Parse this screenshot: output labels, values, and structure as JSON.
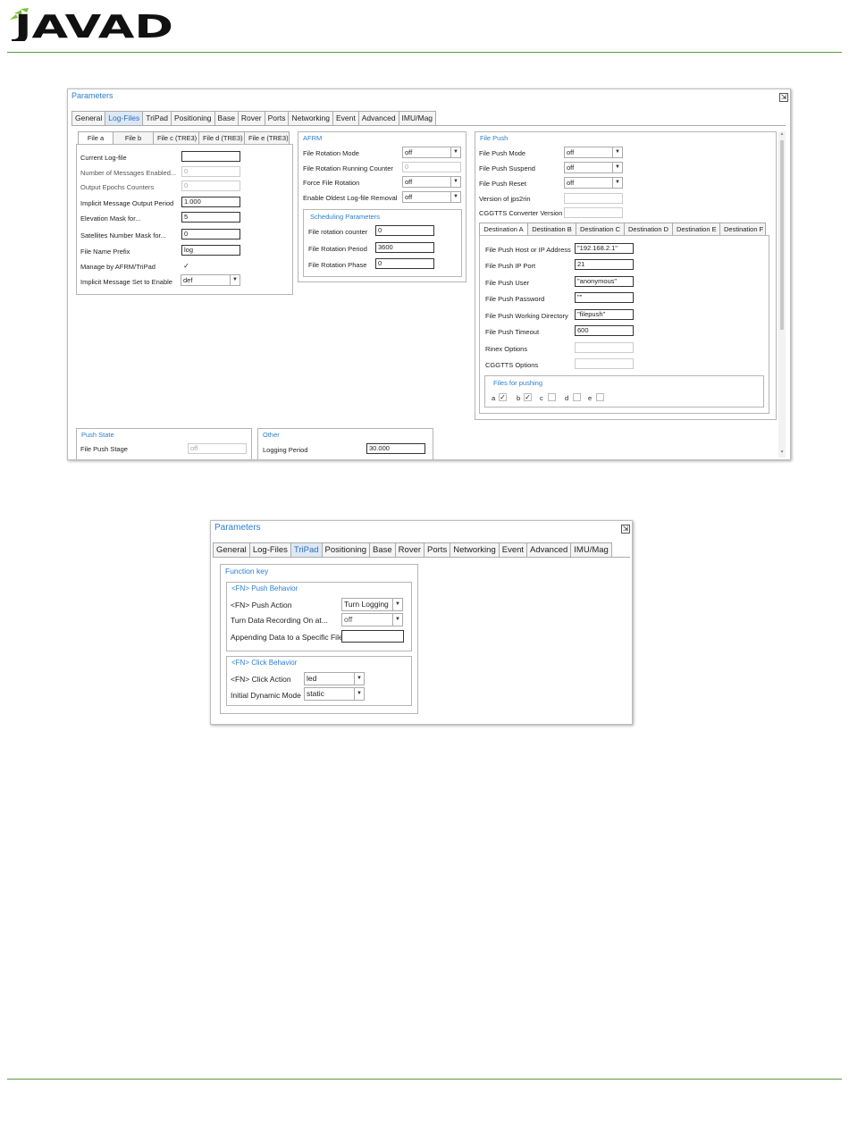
{
  "brand": {
    "logo_text": "JAVAD",
    "accent": "#5a9a3c",
    "link_color": "#2a7ed3"
  },
  "win1": {
    "title": "Parameters",
    "tabs": [
      "General",
      "Log-Files",
      "TriPad",
      "Positioning",
      "Base",
      "Rover",
      "Ports",
      "Networking",
      "Event",
      "Advanced",
      "IMU/Mag"
    ],
    "active_tab": "Log-Files",
    "file_tabs": [
      "File a",
      "File b",
      "File c (TRE3)",
      "File d (TRE3)",
      "File e (TRE3)"
    ],
    "file": {
      "current_log_label": "Current Log-file",
      "current_log_value": "",
      "num_msgs_label": "Number of Messages Enabled...",
      "num_msgs_value": "0",
      "out_epochs_label": "Output Epochs Counters",
      "out_epochs_value": "0",
      "impl_period_label": "Implicit Message Output Period",
      "impl_period_value": "1.000",
      "elev_mask_label": "Elevation Mask for...",
      "elev_mask_value": "5",
      "sat_mask_label": "Satellites Number Mask for...",
      "sat_mask_value": "0",
      "prefix_label": "File Name Prefix",
      "prefix_value": "log",
      "manage_label": "Manage by AFRM/TriPad",
      "manage_check": "✓",
      "impl_set_label": "Implicit Message Set to Enable",
      "impl_set_value": "def"
    },
    "afrm": {
      "title": "AFRM",
      "rot_mode_label": "File Rotation Mode",
      "rot_mode_value": "off",
      "rot_counter_label": "File Rotation Running Counter",
      "rot_counter_value": "0",
      "force_label": "Force File Rotation",
      "force_value": "off",
      "oldest_label": "Enable Oldest Log-file Removal",
      "oldest_value": "off",
      "sched_title": "Scheduling Parameters",
      "sched_counter_label": "File rotation counter",
      "sched_counter_value": "0",
      "sched_period_label": "File Rotation Period",
      "sched_period_value": "3600",
      "sched_phase_label": "File Rotation Phase",
      "sched_phase_value": "0"
    },
    "push": {
      "title": "File Push",
      "mode_label": "File Push Mode",
      "mode_value": "off",
      "suspend_label": "File Push Suspend",
      "suspend_value": "off",
      "reset_label": "File Push Reset",
      "reset_value": "off",
      "jps_label": "Version of jps2rin",
      "jps_value": "",
      "cggtts_ver_label": "CGGTTS Converter Version",
      "cggtts_ver_value": "",
      "dest_tabs": [
        "Destination A",
        "Destination B",
        "Destination C",
        "Destination D",
        "Destination E",
        "Destination F"
      ],
      "host_label": "File Push Host or IP Address",
      "host_value": "\"192.168.2.1\"",
      "port_label": "File Push IP Port",
      "port_value": "21",
      "user_label": "File Push User",
      "user_value": "\"anonymous\"",
      "pass_label": "File Push Password",
      "pass_value": "\"\"",
      "dir_label": "File Push Working Directory",
      "dir_value": "\"filepush\"",
      "timeout_label": "File Push Timeout",
      "timeout_value": "600",
      "rinex_label": "Rinex Options",
      "rinex_value": "",
      "cggtts_opt_label": "CGGTTS Options",
      "cggtts_opt_value": "",
      "files_title": "Files for pushing",
      "files": [
        {
          "label": "a",
          "check": "✓"
        },
        {
          "label": "b",
          "check": "✓"
        },
        {
          "label": "c",
          "check": ""
        },
        {
          "label": "d",
          "check": ""
        },
        {
          "label": "e",
          "check": ""
        }
      ]
    },
    "push_state": {
      "title": "Push State",
      "stage_label": "File Push Stage",
      "stage_value": "off"
    },
    "other": {
      "title": "Other",
      "period_label": "Logging Period",
      "period_value": "30.000"
    }
  },
  "win2": {
    "title": "Parameters",
    "tabs": [
      "General",
      "Log-Files",
      "TriPad",
      "Positioning",
      "Base",
      "Rover",
      "Ports",
      "Networking",
      "Event",
      "Advanced",
      "IMU/Mag"
    ],
    "active_tab": "TriPad",
    "fn_title": "Function key",
    "push_title": "<FN> Push Behavior",
    "push_action_label": "<FN> Push Action",
    "push_action_value": "Turn Logging",
    "turn_rec_label": "Turn Data Recording On at...",
    "turn_rec_value": "off",
    "append_label": "Appending Data to a Specific File",
    "append_value": "",
    "click_title": "<FN> Click Behavior",
    "click_action_label": "<FN> Click Action",
    "click_action_value": "led",
    "dyn_mode_label": "Initial Dynamic Mode",
    "dyn_mode_value": "static"
  }
}
